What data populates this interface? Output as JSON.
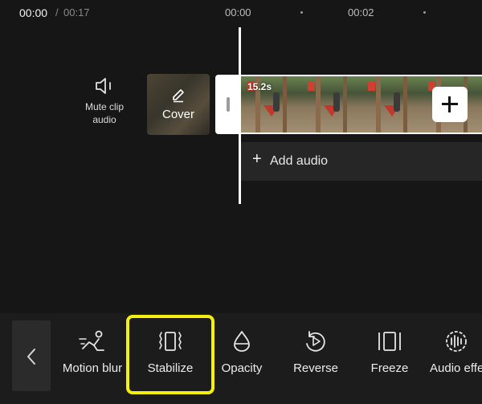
{
  "header": {
    "current_time": "00:00",
    "separator": "/",
    "total_time": "00:17",
    "ruler": [
      "00:00",
      "00:02"
    ]
  },
  "track": {
    "mute_label": "Mute clip audio",
    "cover_label": "Cover",
    "clip_duration": "15.2s",
    "add_audio_label": "Add audio"
  },
  "toolbar": {
    "tools": [
      {
        "label": "Motion blur",
        "icon": "motion-blur-icon"
      },
      {
        "label": "Stabilize",
        "icon": "stabilize-icon"
      },
      {
        "label": "Opacity",
        "icon": "opacity-icon"
      },
      {
        "label": "Reverse",
        "icon": "reverse-icon"
      },
      {
        "label": "Freeze",
        "icon": "freeze-icon"
      },
      {
        "label": "Audio effects",
        "icon": "audio-effects-icon"
      }
    ],
    "highlighted_tool": "Stabilize",
    "highlight_color": "#f4f00e"
  }
}
